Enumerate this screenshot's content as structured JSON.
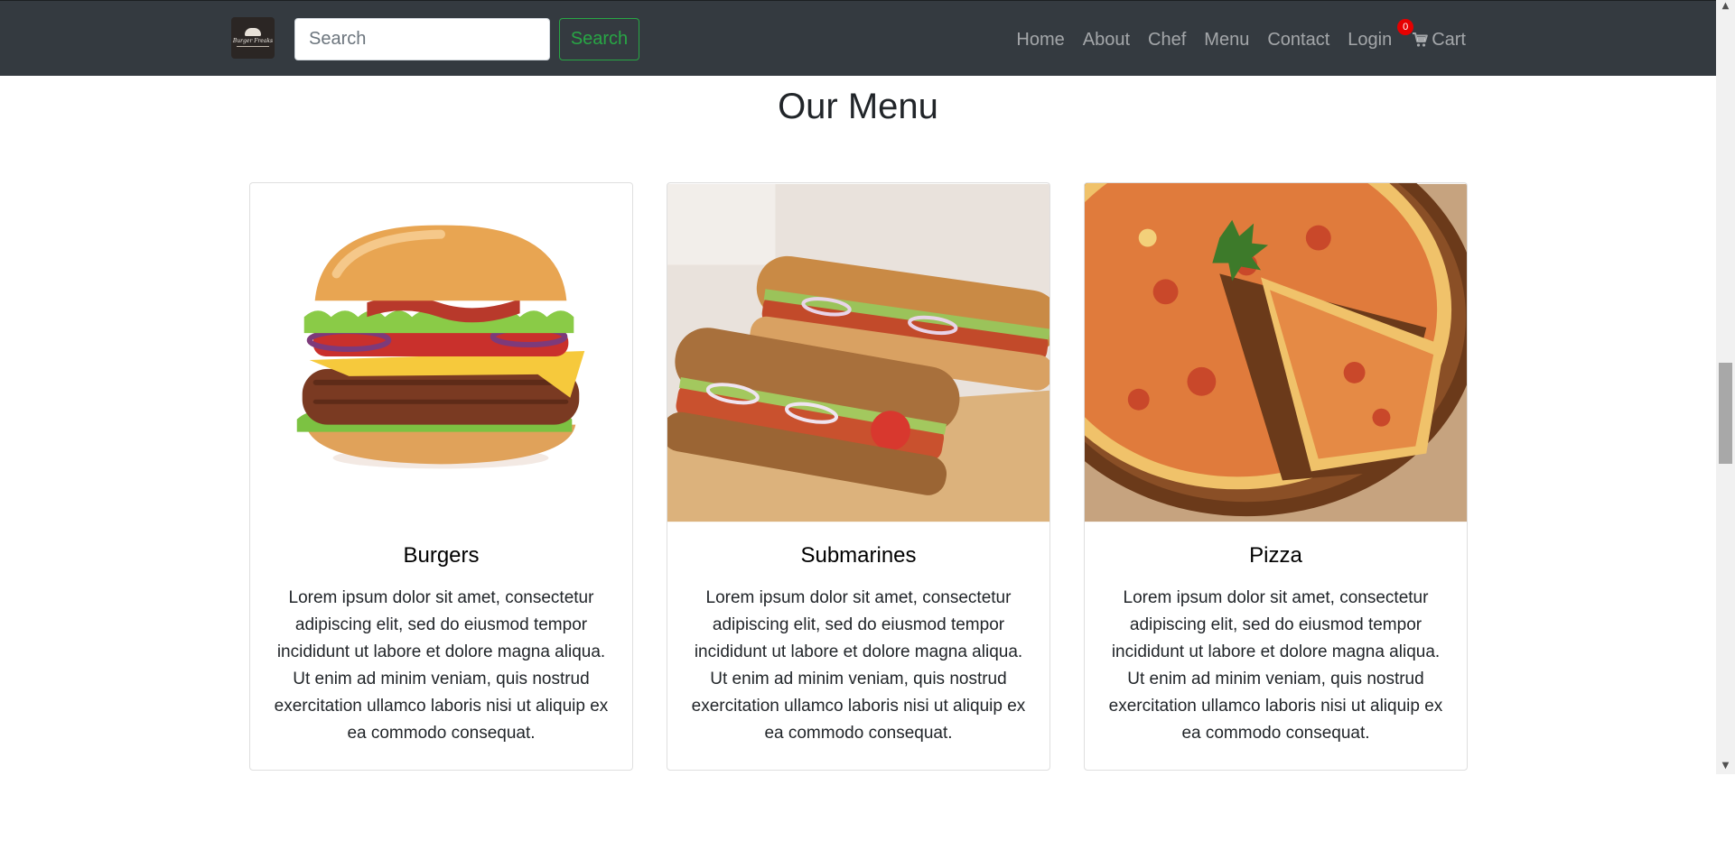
{
  "navbar": {
    "logo_text": "Burger Freaks",
    "search": {
      "placeholder": "Search",
      "value": ""
    },
    "search_button": "Search",
    "links": [
      "Home",
      "About",
      "Chef",
      "Menu",
      "Contact",
      "Login"
    ],
    "cart": {
      "label": "Cart",
      "count": "0"
    },
    "colors": {
      "background": "#343a40",
      "link": "rgba(255,255,255,0.55)",
      "search_button": "#28a745",
      "badge": "#e60000"
    }
  },
  "main": {
    "title": "Our Menu",
    "cards": [
      {
        "image_icon": "burger-image",
        "title": "Burgers",
        "text": "Lorem ipsum dolor sit amet, consectetur adipiscing elit, sed do eiusmod tempor incididunt ut labore et dolore magna aliqua. Ut enim ad minim veniam, quis nostrud exercitation ullamco laboris nisi ut aliquip ex ea commodo consequat."
      },
      {
        "image_icon": "submarine-sandwich-image",
        "title": "Submarines",
        "text": "Lorem ipsum dolor sit amet, consectetur adipiscing elit, sed do eiusmod tempor incididunt ut labore et dolore magna aliqua. Ut enim ad minim veniam, quis nostrud exercitation ullamco laboris nisi ut aliquip ex ea commodo consequat."
      },
      {
        "image_icon": "pizza-image",
        "title": "Pizza",
        "text": "Lorem ipsum dolor sit amet, consectetur adipiscing elit, sed do eiusmod tempor incididunt ut labore et dolore magna aliqua. Ut enim ad minim veniam, quis nostrud exercitation ullamco laboris nisi ut aliquip ex ea commodo consequat."
      }
    ]
  }
}
